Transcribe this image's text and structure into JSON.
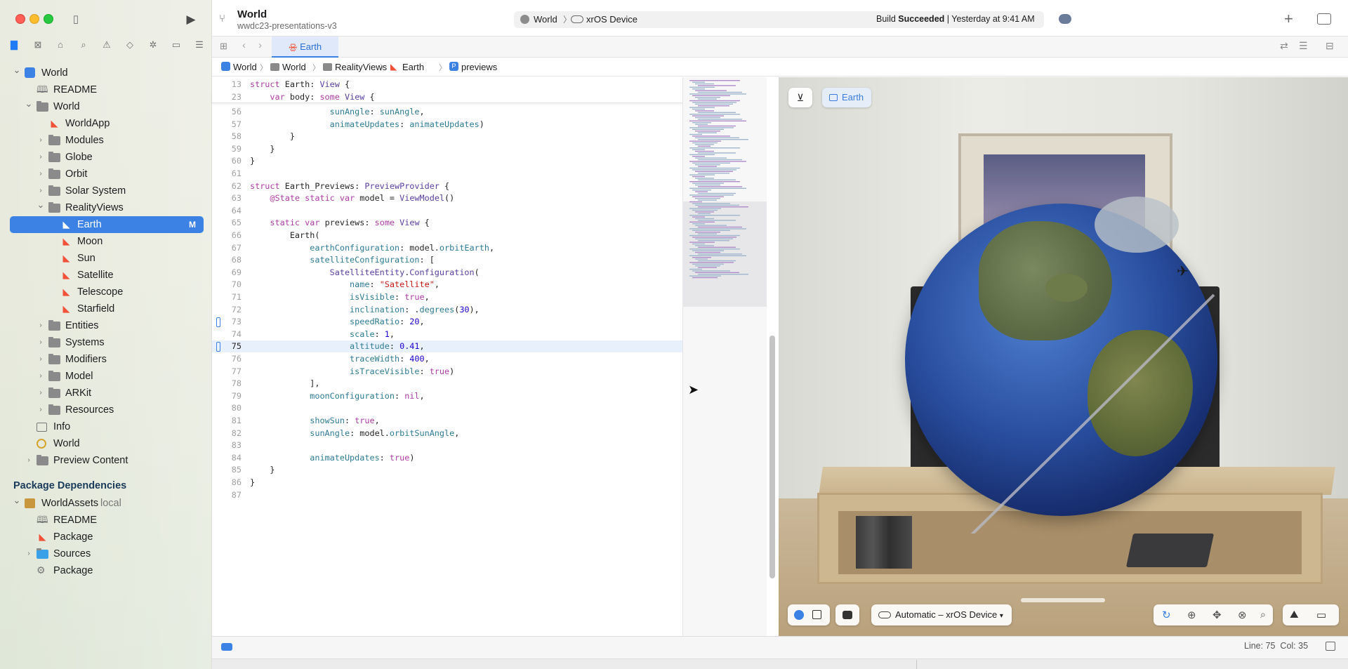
{
  "window": {
    "project_title": "World",
    "project_subtitle": "wwdc23-presentations-v3",
    "scheme_target": "World",
    "scheme_device": "xrOS Device",
    "build_status_prefix": "Build",
    "build_status_bold": "Succeeded",
    "build_time": "| Yesterday at 9:41 AM"
  },
  "tabs": [
    {
      "label": "Earth"
    }
  ],
  "jumpbar": [
    "World",
    "World",
    "RealityViews",
    "Earth",
    "previews"
  ],
  "navigator": {
    "items": [
      {
        "label": "World",
        "icon": "app-project-icon",
        "indent": 0,
        "chevron": "down"
      },
      {
        "label": "README",
        "icon": "book-icon",
        "indent": 1
      },
      {
        "label": "World",
        "icon": "folder-icon",
        "indent": 1,
        "chevron": "down"
      },
      {
        "label": "WorldApp",
        "icon": "swift-file-icon",
        "indent": 2
      },
      {
        "label": "Modules",
        "icon": "folder-icon",
        "indent": 2,
        "chevron": "right"
      },
      {
        "label": "Globe",
        "icon": "folder-icon",
        "indent": 2,
        "chevron": "right"
      },
      {
        "label": "Orbit",
        "icon": "folder-icon",
        "indent": 2,
        "chevron": "right"
      },
      {
        "label": "Solar System",
        "icon": "folder-icon",
        "indent": 2,
        "chevron": "right"
      },
      {
        "label": "RealityViews",
        "icon": "folder-icon",
        "indent": 2,
        "chevron": "down"
      },
      {
        "label": "Earth",
        "icon": "swift-file-icon",
        "indent": 3,
        "badge": "M"
      },
      {
        "label": "Moon",
        "icon": "swift-file-icon",
        "indent": 3
      },
      {
        "label": "Sun",
        "icon": "swift-file-icon",
        "indent": 3
      },
      {
        "label": "Satellite",
        "icon": "swift-file-icon",
        "indent": 3
      },
      {
        "label": "Telescope",
        "icon": "swift-file-icon",
        "indent": 3
      },
      {
        "label": "Starfield",
        "icon": "swift-file-icon",
        "indent": 3
      },
      {
        "label": "Entities",
        "icon": "folder-icon",
        "indent": 2,
        "chevron": "right"
      },
      {
        "label": "Systems",
        "icon": "folder-icon",
        "indent": 2,
        "chevron": "right"
      },
      {
        "label": "Modifiers",
        "icon": "folder-icon",
        "indent": 2,
        "chevron": "right"
      },
      {
        "label": "Model",
        "icon": "folder-icon",
        "indent": 2,
        "chevron": "right"
      },
      {
        "label": "ARKit",
        "icon": "folder-icon",
        "indent": 2,
        "chevron": "right"
      },
      {
        "label": "Resources",
        "icon": "folder-icon",
        "indent": 2,
        "chevron": "right"
      },
      {
        "label": "Info",
        "icon": "table-icon",
        "indent": 1
      },
      {
        "label": "World",
        "icon": "entitlements-icon",
        "indent": 1
      },
      {
        "label": "Preview Content",
        "icon": "folder-icon",
        "indent": 1,
        "chevron": "right"
      }
    ],
    "package_header": "Package Dependencies",
    "package_items": [
      {
        "label": "WorldAssets",
        "suffix": "local",
        "icon": "package-icon",
        "indent": 0,
        "chevron": "down"
      },
      {
        "label": "README",
        "icon": "book-icon",
        "indent": 1
      },
      {
        "label": "Package",
        "icon": "swift-file-icon",
        "indent": 1
      },
      {
        "label": "Sources",
        "icon": "blue-folder-icon",
        "indent": 1,
        "chevron": "right"
      },
      {
        "label": "Package",
        "icon": "gear-package-icon",
        "indent": 1
      }
    ]
  },
  "code": {
    "sticky": [
      {
        "n": "13",
        "text": "struct Earth: View {"
      },
      {
        "n": "23",
        "text": "    var body: some View {"
      }
    ],
    "lines": [
      {
        "n": "56",
        "text": "                sunAngle: sunAngle,"
      },
      {
        "n": "57",
        "text": "                animateUpdates: animateUpdates)"
      },
      {
        "n": "58",
        "text": "        }"
      },
      {
        "n": "59",
        "text": "    }"
      },
      {
        "n": "60",
        "text": "}"
      },
      {
        "n": "61",
        "text": ""
      },
      {
        "n": "62",
        "text": "struct Earth_Previews: PreviewProvider {"
      },
      {
        "n": "63",
        "text": "    @State static var model = ViewModel()"
      },
      {
        "n": "64",
        "text": ""
      },
      {
        "n": "65",
        "text": "    static var previews: some View {"
      },
      {
        "n": "66",
        "text": "        Earth("
      },
      {
        "n": "67",
        "text": "            earthConfiguration: model.orbitEarth,"
      },
      {
        "n": "68",
        "text": "            satelliteConfiguration: ["
      },
      {
        "n": "69",
        "text": "                SatelliteEntity.Configuration("
      },
      {
        "n": "70",
        "text": "                    name: \"Satellite\","
      },
      {
        "n": "71",
        "text": "                    isVisible: true,"
      },
      {
        "n": "72",
        "text": "                    inclination: .degrees(30),"
      },
      {
        "n": "73",
        "text": "                    speedRatio: 20,"
      },
      {
        "n": "74",
        "text": "                    scale: 1,"
      },
      {
        "n": "75",
        "text": "                    altitude: 0.41,"
      },
      {
        "n": "76",
        "text": "                    traceWidth: 400,"
      },
      {
        "n": "77",
        "text": "                    isTraceVisible: true)"
      },
      {
        "n": "78",
        "text": "            ],"
      },
      {
        "n": "79",
        "text": "            moonConfiguration: nil,"
      },
      {
        "n": "80",
        "text": ""
      },
      {
        "n": "81",
        "text": "            showSun: true,"
      },
      {
        "n": "82",
        "text": "            sunAngle: model.orbitSunAngle,"
      },
      {
        "n": "83",
        "text": ""
      },
      {
        "n": "84",
        "text": "            animateUpdates: true)"
      },
      {
        "n": "85",
        "text": "    }"
      },
      {
        "n": "86",
        "text": "}"
      },
      {
        "n": "87",
        "text": ""
      }
    ],
    "current_line": "75"
  },
  "preview": {
    "pin_label": "Earth",
    "device_label": "Automatic – xrOS Device"
  },
  "statusbar": {
    "line_col": "Line: 75  Col: 35"
  },
  "colors": {
    "accent": "#3b82e4",
    "swift": "#f05138",
    "keyword": "#ad3da4"
  }
}
